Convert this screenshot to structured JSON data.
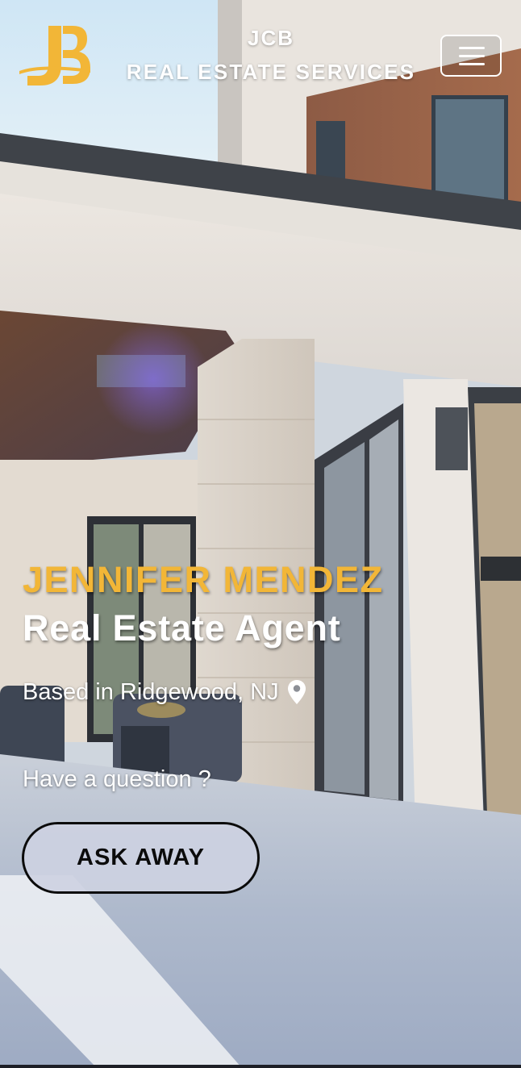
{
  "header": {
    "logo_icon": "jcb-monogram-logo",
    "brand_line1": "JCB",
    "brand_line2": "REAL ESTATE SERVICES",
    "menu_icon": "hamburger-menu-icon"
  },
  "hero": {
    "name": "JENNIFER MENDEZ",
    "title": "Real Estate Agent",
    "location": "Based in Ridgewood, NJ",
    "location_icon": "map-pin-icon",
    "question": "Have a question ?",
    "cta_label": "ASK AWAY"
  },
  "colors": {
    "accent_gold": "#f2b637",
    "text_white": "#ffffff",
    "button_text": "#0b0b0b"
  }
}
